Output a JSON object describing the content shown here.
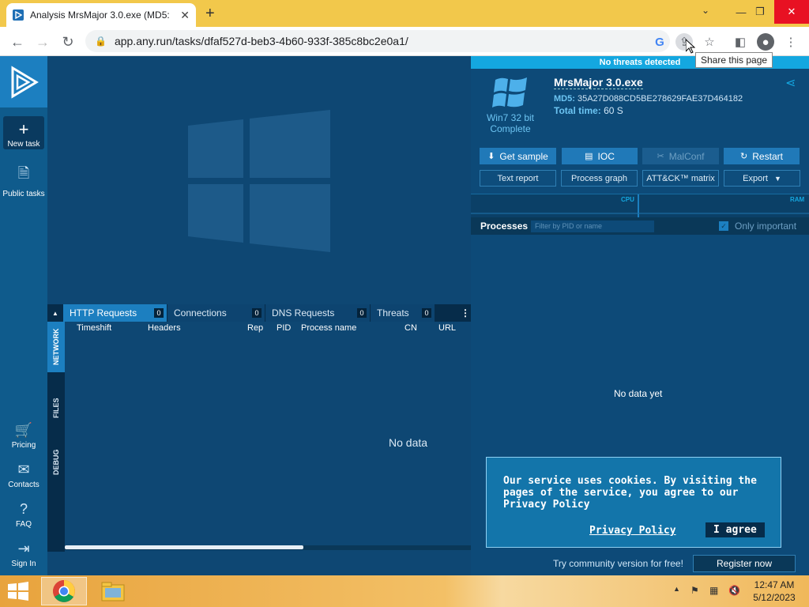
{
  "browser": {
    "tab_title": "Analysis MrsMajor 3.0.exe (MD5:",
    "url": "app.any.run/tasks/dfaf527d-beb3-4b60-933f-385c8bc2e0a1/",
    "tooltip": "Share this page"
  },
  "sidebar": {
    "new_task": "New task",
    "public_tasks": "Public tasks",
    "pricing": "Pricing",
    "contacts": "Contacts",
    "faq": "FAQ",
    "sign_in": "Sign In"
  },
  "network": {
    "tabs": [
      {
        "label": "HTTP Requests",
        "count": "0"
      },
      {
        "label": "Connections",
        "count": "0"
      },
      {
        "label": "DNS Requests",
        "count": "0"
      },
      {
        "label": "Threats",
        "count": "0"
      }
    ],
    "side_tabs": [
      "NETWORK",
      "FILES",
      "DEBUG"
    ],
    "columns": [
      "Timeshift",
      "Headers",
      "Rep",
      "PID",
      "Process name",
      "CN",
      "URL"
    ],
    "empty": "No data"
  },
  "task": {
    "status_bar": "No threats detected",
    "file_name": "MrsMajor 3.0.exe",
    "md5_label": "MD5:",
    "md5": "35A27D088CD5BE278629FAE37D464182",
    "total_time_label": "Total time:",
    "total_time": "60 S",
    "os": "Win7 32 bit",
    "os_status": "Complete",
    "buttons": {
      "get_sample": "Get sample",
      "ioc": "IOC",
      "malconf": "MalConf",
      "restart": "Restart",
      "text_report": "Text report",
      "process_graph": "Process graph",
      "attck": "ATT&CK™ matrix",
      "export": "Export"
    },
    "graph": {
      "cpu": "CPU",
      "ram": "RAM"
    },
    "processes_title": "Processes",
    "filter_placeholder": "Filter by PID or name",
    "only_important": "Only important",
    "no_data_yet": "No data yet"
  },
  "cookie": {
    "message": "Our service uses cookies. By visiting the pages of the service, you agree to our Privacy Policy",
    "privacy_link": "Privacy Policy",
    "agree": "I agree"
  },
  "footer": {
    "community": "Try community version for free!",
    "register": "Register now"
  },
  "taskbar": {
    "time": "12:47 AM",
    "date": "5/12/2023"
  },
  "colors": {
    "accent": "#1c7fc0",
    "threat_bar": "#14a7e0",
    "panel_bg": "#0d4a78",
    "taskbar": "#e8a33d"
  }
}
